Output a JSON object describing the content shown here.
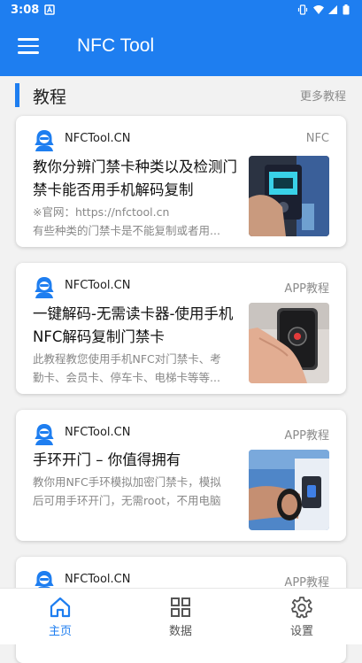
{
  "status_bar": {
    "time": "3:08"
  },
  "app_bar": {
    "title": "NFC Tool"
  },
  "section": {
    "title": "教程",
    "more": "更多教程"
  },
  "cards": [
    {
      "source": "NFCTool.CN",
      "tag": "NFC",
      "title": "教你分辨门禁卡种类以及检测门禁卡能否用手机解码复制",
      "desc_line1": "※官网：https://nfctool.cn",
      "desc_line2": "有些种类的门禁卡是不能复制或者用..."
    },
    {
      "source": "NFCTool.CN",
      "tag": "APP教程",
      "title": "一键解码-无需读卡器-使用手机NFC解码复制门禁卡",
      "desc_line1": "此教程教您使用手机NFC对门禁卡、考",
      "desc_line2": "勤卡、会员卡、停车卡、电梯卡等等..."
    },
    {
      "source": "NFCTool.CN",
      "tag": "APP教程",
      "title": "手环开门 – 你值得拥有",
      "desc_line1": "教你用NFC手环模拟加密门禁卡，模拟",
      "desc_line2": "后可用手环开门，无需root，不用电脑"
    },
    {
      "source": "NFCTool.CN",
      "tag": "APP教程"
    }
  ],
  "bottom_nav": [
    {
      "label": "主页",
      "icon": "home-icon",
      "active": true
    },
    {
      "label": "数据",
      "icon": "grid-icon",
      "active": false
    },
    {
      "label": "设置",
      "icon": "gear-icon",
      "active": false
    }
  ],
  "colors": {
    "primary": "#1e7ef0",
    "active_nav": "#1e7ef0",
    "inactive_nav": "#555555"
  }
}
